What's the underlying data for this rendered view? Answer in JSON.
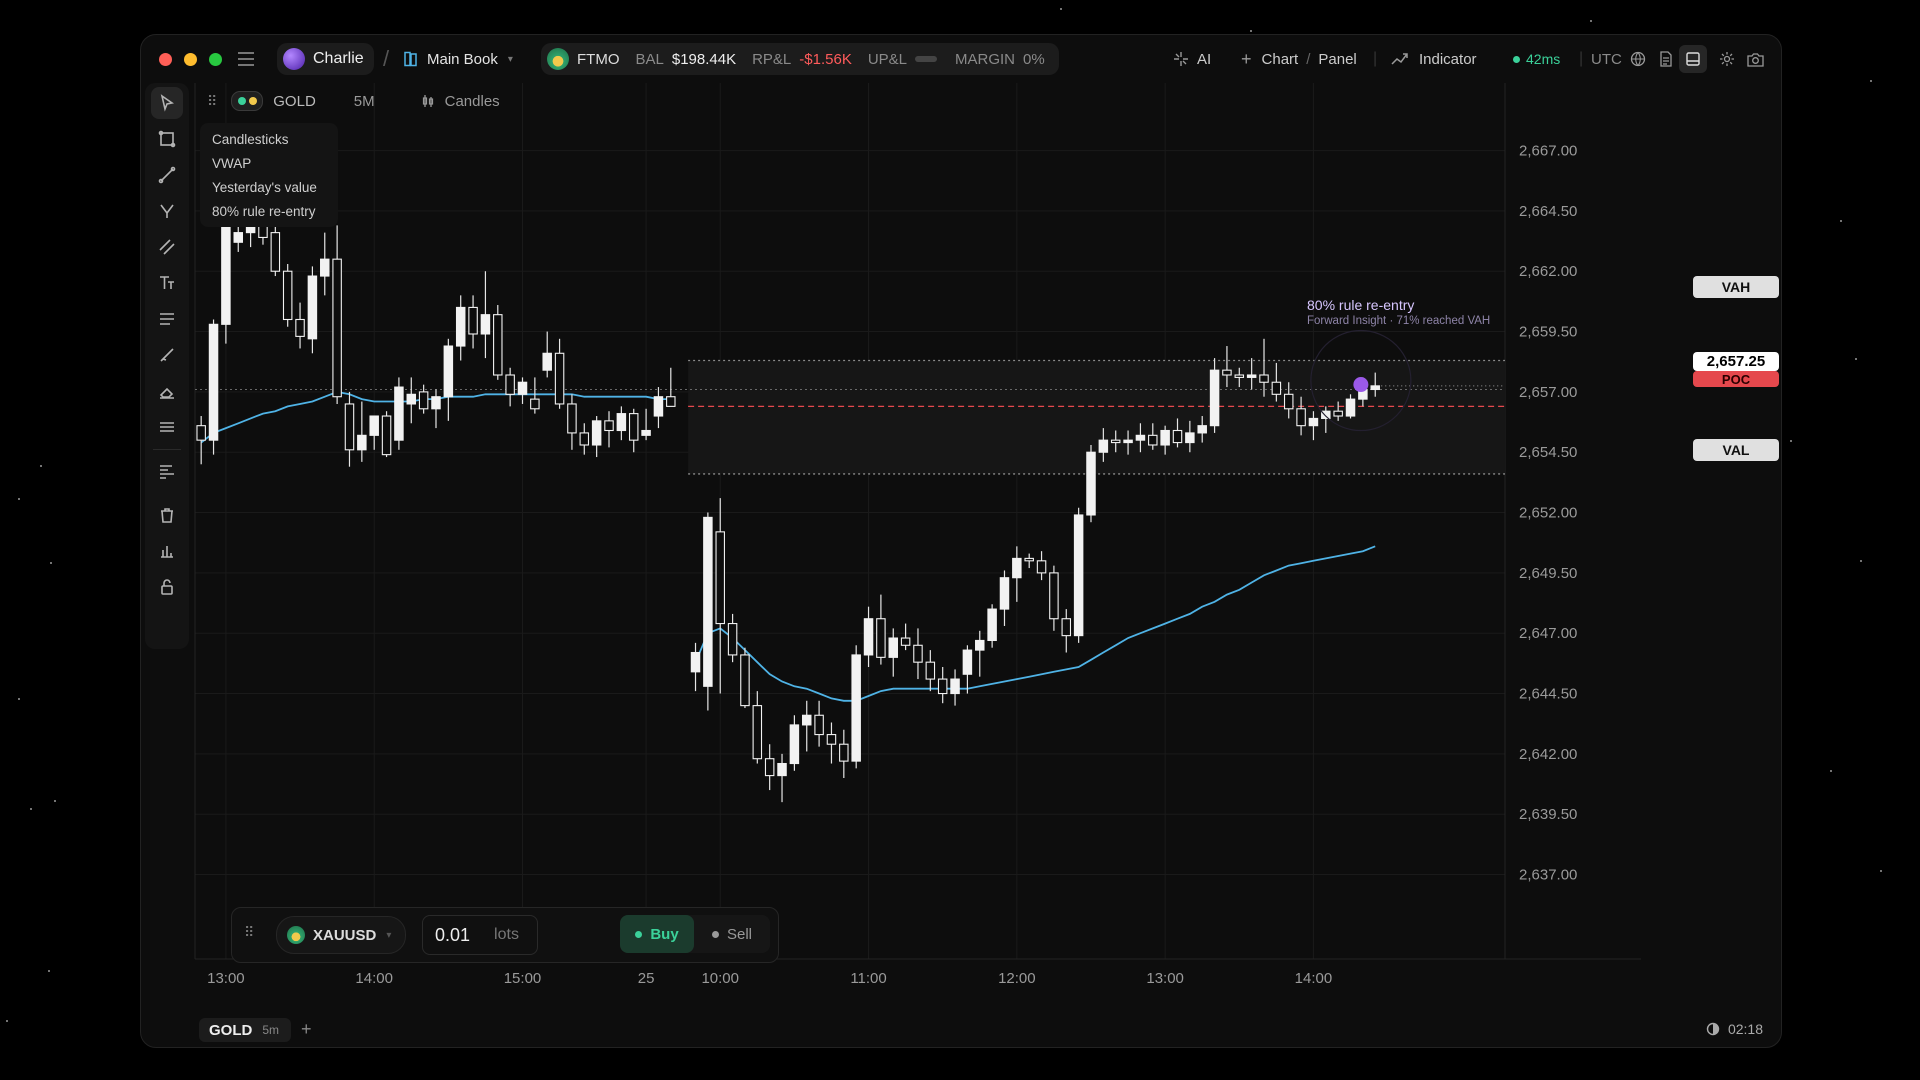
{
  "topbar": {
    "user": "Charlie",
    "book": "Main Book",
    "account": "FTMO",
    "bal_label": "BAL",
    "bal_value": "$198.44K",
    "rpl_label": "RP&L",
    "rpl_value": "-$1.56K",
    "upl_label": "UP&L",
    "margin_label": "MARGIN",
    "margin_value": "0%",
    "ai_label": "AI",
    "chart_label": "Chart",
    "panel_label": "Panel",
    "indicator_label": "Indicator",
    "latency": "42ms",
    "timezone": "UTC"
  },
  "chart_tabs": {
    "symbol": "GOLD",
    "interval": "5M",
    "style": "Candles"
  },
  "legend": [
    "Candlesticks",
    "VWAP",
    "Yesterday's value",
    "80% rule re-entry"
  ],
  "insight": {
    "title": "80% rule re-entry",
    "subtitle": "Forward Insight · 71% reached VAH",
    "color": "#9b59e8"
  },
  "levels": {
    "vah": "VAH",
    "poc": "POC",
    "val": "VAL",
    "last": "2,657.25"
  },
  "ticket": {
    "symbol": "XAUUSD",
    "lots": "0.01",
    "lots_unit": "lots",
    "buy": "Buy",
    "sell": "Sell"
  },
  "bottom": {
    "tab_symbol": "GOLD",
    "tab_interval": "5m",
    "add": "+",
    "clock": "02:18"
  },
  "colors": {
    "accent_green": "#3bd19a",
    "negative": "#ff5b5b",
    "vwap": "#4fb3e6",
    "poc": "#e5484d",
    "insight": "#9b59e8"
  },
  "chart_data": {
    "type": "candlestick",
    "symbol": "GOLD",
    "interval": "5M",
    "y_ticks": [
      "2,667.00",
      "2,664.50",
      "2,662.00",
      "2,659.50",
      "2,657.00",
      "2,654.50",
      "2,652.00",
      "2,649.50",
      "2,647.00",
      "2,644.50",
      "2,642.00",
      "2,639.50",
      "2,637.00"
    ],
    "y_tick_values": [
      2667.0,
      2664.5,
      2662.0,
      2659.5,
      2657.0,
      2654.5,
      2652.0,
      2649.5,
      2647.0,
      2644.5,
      2642.0,
      2639.5,
      2637.0
    ],
    "ylim": [
      2633.5,
      2669.8
    ],
    "x_ticks": [
      "13:00",
      "14:00",
      "15:00",
      "25",
      "10:00",
      "11:00",
      "12:00",
      "13:00",
      "14:00"
    ],
    "x_tick_index": [
      2,
      14,
      26,
      36,
      42,
      54,
      66,
      78,
      90
    ],
    "n_slots": 106,
    "levels": {
      "VAH": 2658.3,
      "POC": 2656.4,
      "VAL": 2653.6,
      "last": 2657.25,
      "prev_close": 2657.1
    },
    "candles_day1": [
      [
        2655.6,
        2656.0,
        2654.0,
        2655.0
      ],
      [
        2655.0,
        2660.0,
        2654.4,
        2659.8
      ],
      [
        2659.8,
        2664.8,
        2659.0,
        2664.2
      ],
      [
        2663.2,
        2664.6,
        2662.8,
        2663.6
      ],
      [
        2663.6,
        2664.9,
        2663.0,
        2664.2
      ],
      [
        2664.2,
        2665.2,
        2663.1,
        2663.4
      ],
      [
        2663.6,
        2664.4,
        2661.8,
        2662.0
      ],
      [
        2662.0,
        2662.3,
        2659.7,
        2660.0
      ],
      [
        2660.0,
        2660.7,
        2658.8,
        2659.3
      ],
      [
        2659.2,
        2662.2,
        2658.6,
        2661.8
      ],
      [
        2661.8,
        2663.6,
        2661.0,
        2662.5
      ],
      [
        2662.5,
        2663.9,
        2656.5,
        2656.8
      ],
      [
        2656.5,
        2657.0,
        2653.9,
        2654.6
      ],
      [
        2654.6,
        2656.6,
        2654.1,
        2655.2
      ],
      [
        2655.2,
        2656.0,
        2654.6,
        2656.0
      ],
      [
        2656.0,
        2656.2,
        2654.3,
        2654.4
      ],
      [
        2655.0,
        2657.6,
        2654.6,
        2657.2
      ],
      [
        2656.5,
        2657.6,
        2655.7,
        2656.9
      ],
      [
        2657.0,
        2657.3,
        2656.1,
        2656.3
      ],
      [
        2656.3,
        2657.1,
        2655.5,
        2656.8
      ],
      [
        2656.8,
        2659.2,
        2655.8,
        2658.9
      ],
      [
        2658.9,
        2661.0,
        2658.3,
        2660.5
      ],
      [
        2660.5,
        2661.0,
        2658.8,
        2659.4
      ],
      [
        2659.4,
        2662.0,
        2658.4,
        2660.2
      ],
      [
        2660.2,
        2660.6,
        2657.5,
        2657.7
      ],
      [
        2657.7,
        2658.0,
        2656.4,
        2656.9
      ],
      [
        2656.9,
        2657.6,
        2656.5,
        2657.4
      ],
      [
        2656.7,
        2657.6,
        2656.1,
        2656.3
      ],
      [
        2657.9,
        2659.5,
        2657.6,
        2658.6
      ],
      [
        2658.6,
        2659.2,
        2656.3,
        2656.5
      ],
      [
        2656.5,
        2656.9,
        2654.6,
        2655.3
      ],
      [
        2655.3,
        2655.7,
        2654.4,
        2654.8
      ],
      [
        2654.8,
        2656.0,
        2654.3,
        2655.8
      ],
      [
        2655.8,
        2656.2,
        2654.7,
        2655.4
      ],
      [
        2655.4,
        2656.4,
        2655.0,
        2656.1
      ],
      [
        2656.1,
        2656.3,
        2654.5,
        2655.0
      ],
      [
        2655.2,
        2656.3,
        2655.0,
        2655.4
      ],
      [
        2656.0,
        2657.2,
        2655.5,
        2656.8
      ],
      [
        2656.8,
        2658.0,
        2656.5,
        2656.4
      ]
    ],
    "candles_day2": [
      [
        2645.4,
        2646.6,
        2644.6,
        2646.2
      ],
      [
        2644.8,
        2652.0,
        2643.8,
        2651.8
      ],
      [
        2651.2,
        2652.6,
        2644.5,
        2647.4
      ],
      [
        2647.4,
        2647.8,
        2645.8,
        2646.1
      ],
      [
        2646.1,
        2646.4,
        2643.9,
        2644.0
      ],
      [
        2644.0,
        2644.6,
        2641.6,
        2641.8
      ],
      [
        2641.8,
        2642.4,
        2640.5,
        2641.1
      ],
      [
        2641.1,
        2642.0,
        2640.0,
        2641.6
      ],
      [
        2641.6,
        2643.6,
        2641.3,
        2643.2
      ],
      [
        2643.2,
        2644.2,
        2642.1,
        2643.6
      ],
      [
        2643.6,
        2644.2,
        2642.3,
        2642.8
      ],
      [
        2642.8,
        2643.3,
        2641.6,
        2642.4
      ],
      [
        2642.4,
        2643.0,
        2641.0,
        2641.7
      ],
      [
        2641.7,
        2646.5,
        2641.4,
        2646.1
      ],
      [
        2646.1,
        2648.1,
        2645.6,
        2647.6
      ],
      [
        2647.6,
        2648.6,
        2645.7,
        2646.0
      ],
      [
        2646.0,
        2647.2,
        2645.2,
        2646.8
      ],
      [
        2646.8,
        2647.4,
        2646.3,
        2646.5
      ],
      [
        2646.5,
        2647.2,
        2645.1,
        2645.8
      ],
      [
        2645.8,
        2646.3,
        2644.6,
        2645.1
      ],
      [
        2645.1,
        2645.6,
        2644.1,
        2644.5
      ],
      [
        2644.5,
        2645.5,
        2644.0,
        2645.1
      ],
      [
        2645.3,
        2646.5,
        2644.5,
        2646.3
      ],
      [
        2646.3,
        2647.1,
        2645.2,
        2646.7
      ],
      [
        2646.7,
        2648.2,
        2646.4,
        2648.0
      ],
      [
        2648.0,
        2649.6,
        2647.3,
        2649.3
      ],
      [
        2649.3,
        2650.6,
        2648.3,
        2650.1
      ],
      [
        2650.1,
        2650.3,
        2649.7,
        2650.0
      ],
      [
        2650.0,
        2650.4,
        2649.2,
        2649.5
      ],
      [
        2649.5,
        2649.8,
        2647.1,
        2647.6
      ],
      [
        2647.6,
        2648.0,
        2646.2,
        2646.9
      ],
      [
        2646.9,
        2652.2,
        2646.6,
        2651.9
      ],
      [
        2651.9,
        2654.8,
        2651.6,
        2654.5
      ],
      [
        2654.5,
        2655.5,
        2654.1,
        2655.0
      ],
      [
        2655.0,
        2655.4,
        2654.5,
        2654.9
      ],
      [
        2654.9,
        2655.4,
        2654.4,
        2655.0
      ],
      [
        2655.0,
        2655.7,
        2654.5,
        2655.2
      ],
      [
        2655.2,
        2655.7,
        2654.6,
        2654.8
      ],
      [
        2654.8,
        2655.6,
        2654.4,
        2655.4
      ],
      [
        2655.4,
        2655.9,
        2654.7,
        2654.9
      ],
      [
        2654.9,
        2655.8,
        2654.5,
        2655.3
      ],
      [
        2655.3,
        2656.0,
        2654.9,
        2655.6
      ],
      [
        2655.6,
        2658.4,
        2655.3,
        2657.9
      ],
      [
        2657.9,
        2658.9,
        2657.2,
        2657.7
      ],
      [
        2657.7,
        2658.0,
        2657.2,
        2657.6
      ],
      [
        2657.6,
        2658.4,
        2657.1,
        2657.7
      ],
      [
        2657.7,
        2659.2,
        2656.8,
        2657.4
      ],
      [
        2657.4,
        2658.2,
        2656.6,
        2656.9
      ],
      [
        2656.9,
        2657.4,
        2655.9,
        2656.3
      ],
      [
        2656.3,
        2656.8,
        2655.2,
        2655.6
      ],
      [
        2655.6,
        2656.2,
        2655.0,
        2655.9
      ],
      [
        2655.9,
        2656.4,
        2655.3,
        2656.2
      ],
      [
        2656.2,
        2656.6,
        2655.8,
        2656.0
      ],
      [
        2656.0,
        2656.9,
        2655.9,
        2656.7
      ],
      [
        2656.7,
        2657.6,
        2656.4,
        2657.1
      ],
      [
        2657.1,
        2657.8,
        2656.8,
        2657.25
      ]
    ],
    "vwap_day1": [
      2654.9,
      2655.3,
      2655.5,
      2655.7,
      2655.9,
      2656.1,
      2656.2,
      2656.4,
      2656.5,
      2656.6,
      2656.8,
      2657.0,
      2656.9,
      2656.7,
      2656.6,
      2656.6,
      2656.6,
      2656.6,
      2656.7,
      2656.7,
      2656.8,
      2656.8,
      2656.8,
      2656.9,
      2656.9,
      2656.9,
      2656.9,
      2656.9,
      2656.9,
      2656.9,
      2656.9,
      2656.8,
      2656.8,
      2656.8,
      2656.8,
      2656.8,
      2656.8,
      2656.7,
      2656.7
    ],
    "vwap_day2": [
      2645.8,
      2647.0,
      2647.2,
      2646.8,
      2646.3,
      2645.8,
      2645.3,
      2645.0,
      2644.8,
      2644.7,
      2644.5,
      2644.3,
      2644.2,
      2644.2,
      2644.4,
      2644.6,
      2644.7,
      2644.7,
      2644.7,
      2644.7,
      2644.7,
      2644.7,
      2644.7,
      2644.8,
      2644.9,
      2645.0,
      2645.1,
      2645.2,
      2645.3,
      2645.4,
      2645.5,
      2645.6,
      2645.9,
      2646.2,
      2646.5,
      2646.8,
      2647.0,
      2647.2,
      2647.4,
      2647.6,
      2647.8,
      2648.1,
      2648.3,
      2648.6,
      2648.8,
      2649.1,
      2649.4,
      2649.6,
      2649.8,
      2649.9,
      2650.0,
      2650.1,
      2650.2,
      2650.3,
      2650.4,
      2650.6
    ]
  }
}
